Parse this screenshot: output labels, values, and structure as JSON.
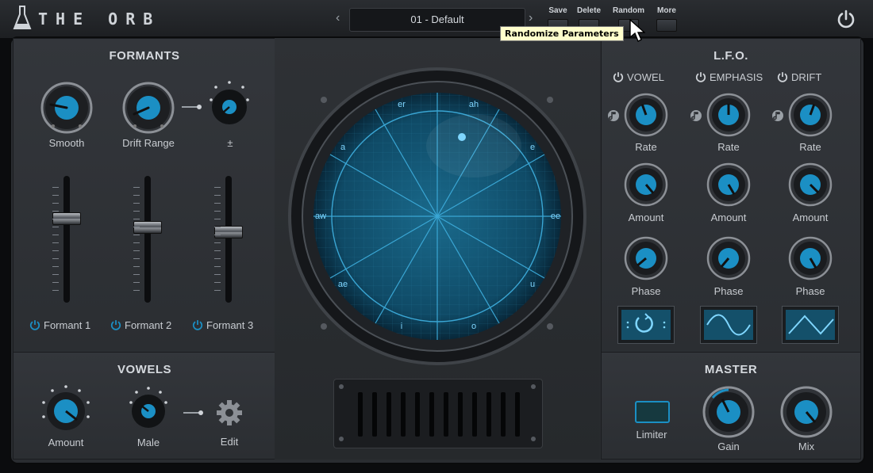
{
  "app": {
    "title": "THE ORB"
  },
  "preset": {
    "name": "01 - Default",
    "prev": "‹",
    "next": "›"
  },
  "toolbar": {
    "save": "Save",
    "delete": "Delete",
    "random": "Random",
    "more": "More"
  },
  "tooltip": "Randomize Parameters",
  "formants": {
    "title": "FORMANTS",
    "knobs": [
      {
        "label": "Smooth"
      },
      {
        "label": "Drift Range"
      },
      {
        "label": "±"
      }
    ],
    "faders": [
      {
        "label": "Formant 1",
        "level": 0.66
      },
      {
        "label": "Formant 2",
        "level": 0.6
      },
      {
        "label": "Formant 3",
        "level": 0.56
      }
    ]
  },
  "vowels": {
    "title": "VOWELS",
    "amount": "Amount",
    "male": "Male",
    "edit": "Edit"
  },
  "orb": {
    "labels": [
      "er",
      "ah",
      "a",
      "e",
      "aw",
      "ee",
      "ae",
      "u",
      "i",
      "o"
    ]
  },
  "lfo": {
    "title": "L.F.O.",
    "columns": [
      {
        "name": "VOWEL",
        "rate": "Rate",
        "amount": "Amount",
        "phase": "Phase",
        "shape": "random"
      },
      {
        "name": "EMPHASIS",
        "rate": "Rate",
        "amount": "Amount",
        "phase": "Phase",
        "shape": "sine"
      },
      {
        "name": "DRIFT",
        "rate": "Rate",
        "amount": "Amount",
        "phase": "Phase",
        "shape": "triangle"
      }
    ]
  },
  "master": {
    "title": "MASTER",
    "limiter": "Limiter",
    "gain": "Gain",
    "mix": "Mix"
  },
  "colors": {
    "accent": "#1b8fc4",
    "orb": "#0f4a66"
  }
}
